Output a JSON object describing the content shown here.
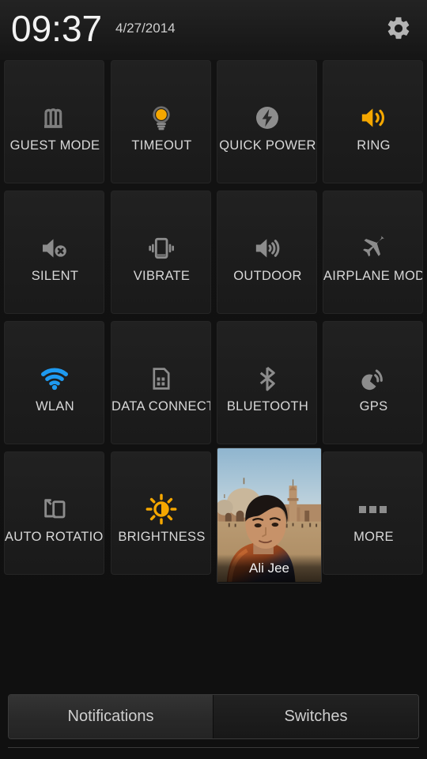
{
  "header": {
    "time": "09:37",
    "date": "4/27/2014",
    "settings_icon": "gear-icon"
  },
  "colors": {
    "background": "#131313",
    "tile": "#1d1d1d",
    "accent_orange": "#f0a202",
    "accent_blue": "#2196f3",
    "icon_inactive": "#8c8c8c",
    "text": "#d8d8d8"
  },
  "grid": {
    "rows": [
      [
        {
          "label": "GUEST MODE",
          "icon": "guest-mode-icon",
          "state": "off",
          "clipped": false
        },
        {
          "label": "TIMEOUT",
          "icon": "lightbulb-icon",
          "state": "on",
          "clipped": false
        },
        {
          "label": "QUICK POWER",
          "icon": "quick-power-icon",
          "state": "off",
          "clipped": true
        },
        {
          "label": "RING",
          "icon": "speaker-on-icon",
          "state": "on",
          "clipped": false
        }
      ],
      [
        {
          "label": "SILENT",
          "icon": "speaker-mute-icon",
          "state": "off",
          "clipped": false
        },
        {
          "label": "VIBRATE",
          "icon": "vibrate-icon",
          "state": "off",
          "clipped": false
        },
        {
          "label": "OUTDOOR",
          "icon": "speaker-loud-icon",
          "state": "off",
          "clipped": false
        },
        {
          "label": "AIRPLANE MODE",
          "icon": "airplane-icon",
          "state": "off",
          "clipped": true
        }
      ],
      [
        {
          "label": "WLAN",
          "icon": "wifi-icon",
          "state": "on",
          "clipped": false
        },
        {
          "label": "DATA CONNECTION",
          "icon": "sim-card-icon",
          "state": "off",
          "clipped": true
        },
        {
          "label": "BLUETOOTH",
          "icon": "bluetooth-icon",
          "state": "off",
          "clipped": false
        },
        {
          "label": "GPS",
          "icon": "gps-satellite-icon",
          "state": "off",
          "clipped": false
        }
      ],
      [
        {
          "label": "AUTO ROTATION",
          "icon": "auto-rotate-icon",
          "state": "off",
          "clipped": true
        },
        {
          "label": "BRIGHTNESS",
          "icon": "brightness-sun-icon",
          "state": "on",
          "clipped": false
        },
        {
          "label": "",
          "icon": "photo-tile",
          "state": "photo",
          "clipped": false
        },
        {
          "label": "MORE",
          "icon": "more-dots-icon",
          "state": "off",
          "clipped": false
        }
      ]
    ]
  },
  "photo_tile": {
    "name": "Ali Jee",
    "scene": "person in front of a mosque with domes and minaret"
  },
  "tabs": [
    {
      "label": "Notifications",
      "active": true
    },
    {
      "label": "Switches",
      "active": false
    }
  ]
}
